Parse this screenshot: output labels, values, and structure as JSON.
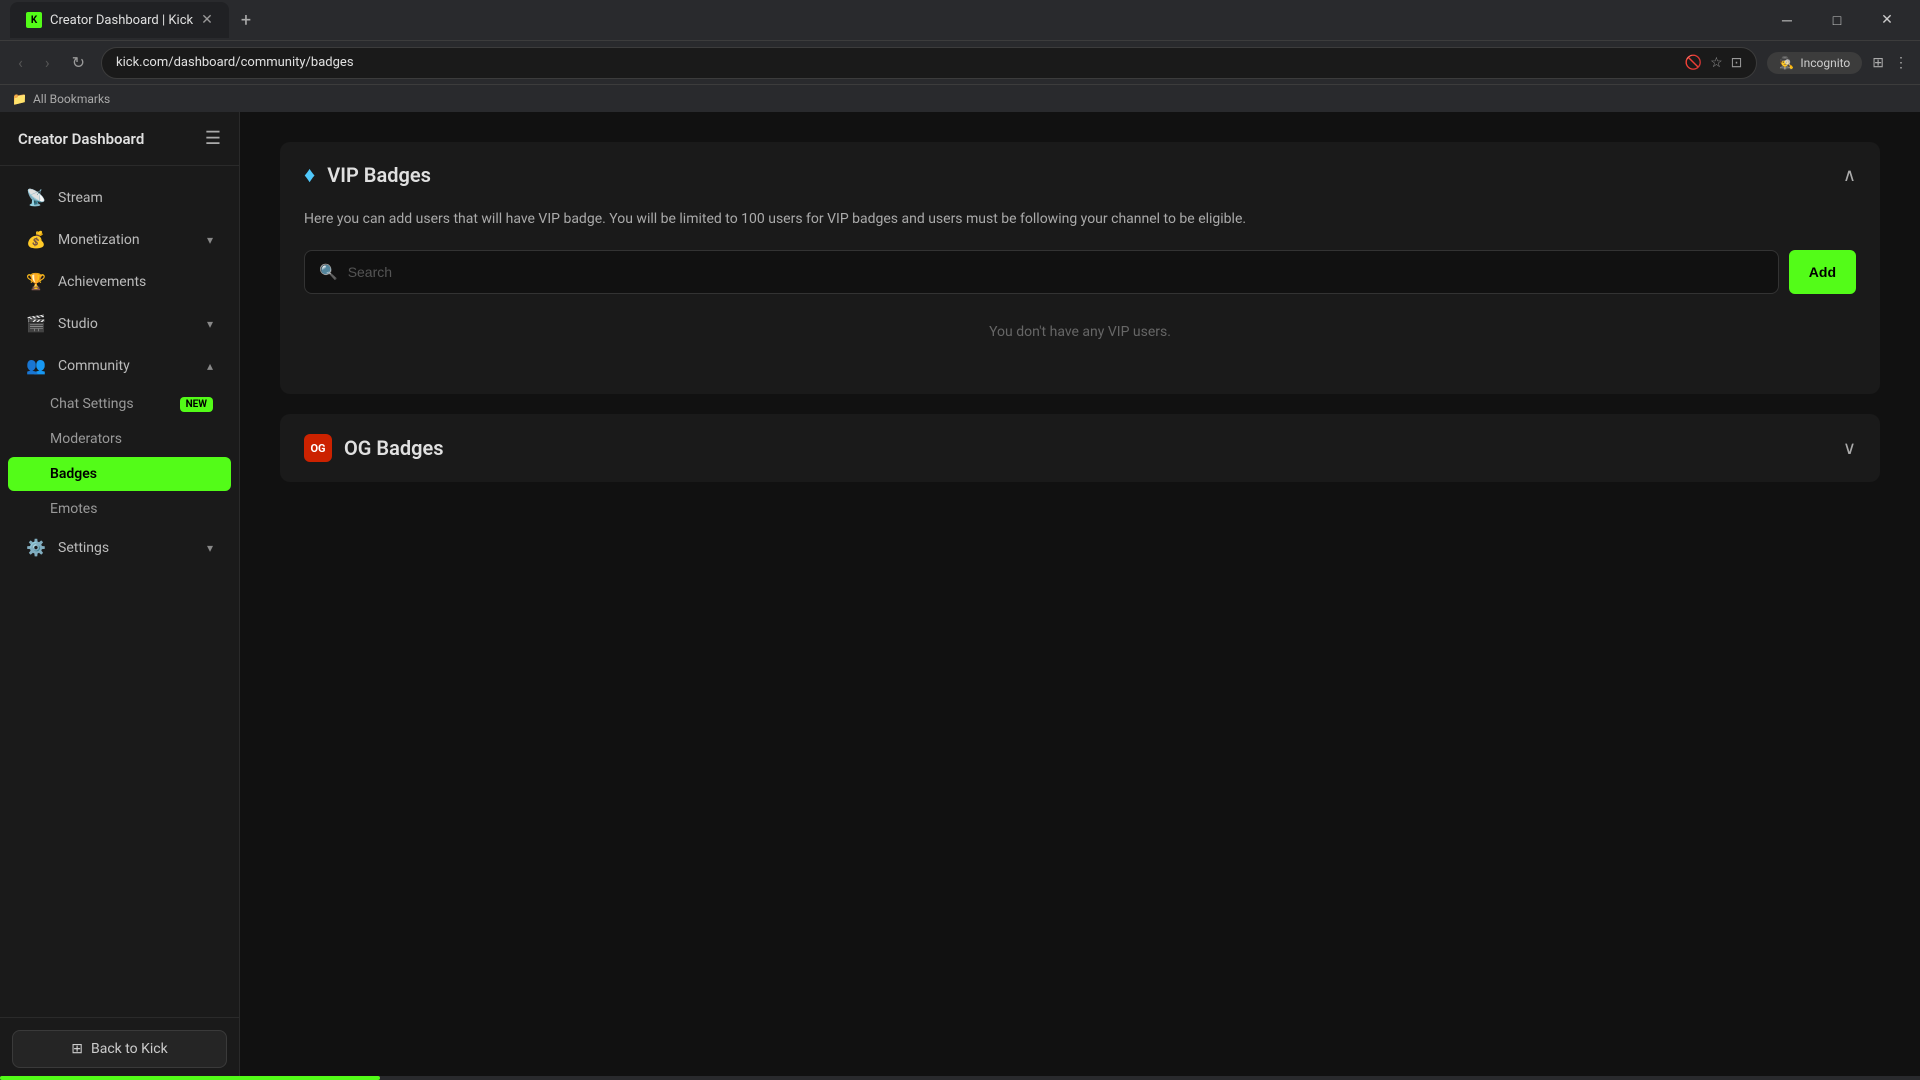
{
  "browser": {
    "tab_title": "Creator Dashboard | Kick",
    "tab_favicon": "K",
    "url": "kick.com/dashboard/community/badges",
    "incognito_label": "Incognito",
    "bookmarks_label": "All Bookmarks"
  },
  "sidebar": {
    "title": "Creator Dashboard",
    "nav_items": [
      {
        "id": "stream",
        "label": "Stream",
        "icon": "📡",
        "has_chevron": false
      },
      {
        "id": "monetization",
        "label": "Monetization",
        "icon": "💰",
        "has_chevron": true
      },
      {
        "id": "achievements",
        "label": "Achievements",
        "icon": "🏆",
        "has_chevron": false
      },
      {
        "id": "studio",
        "label": "Studio",
        "icon": "🎬",
        "has_chevron": true
      },
      {
        "id": "community",
        "label": "Community",
        "icon": "👥",
        "has_chevron": true,
        "expanded": true
      }
    ],
    "community_sub_items": [
      {
        "id": "chat-settings",
        "label": "Chat Settings",
        "has_new": true
      },
      {
        "id": "moderators",
        "label": "Moderators",
        "has_new": false
      },
      {
        "id": "badges",
        "label": "Badges",
        "active": true
      },
      {
        "id": "emotes",
        "label": "Emotes",
        "has_new": false
      }
    ],
    "bottom_nav": [
      {
        "id": "settings",
        "label": "Settings",
        "icon": "⚙️",
        "has_chevron": true
      }
    ],
    "back_to_kick_label": "Back to Kick"
  },
  "main": {
    "vip_badges": {
      "title": "VIP Badges",
      "description": "Here you can add users that will have VIP badge. You will be limited to 100 users for VIP badges and users must be following your channel to be eligible.",
      "search_placeholder": "Search",
      "add_button_label": "Add",
      "empty_message": "You don't have any VIP users.",
      "collapsed": false
    },
    "og_badges": {
      "title": "OG Badges",
      "icon_text": "OG",
      "collapsed": true
    }
  }
}
